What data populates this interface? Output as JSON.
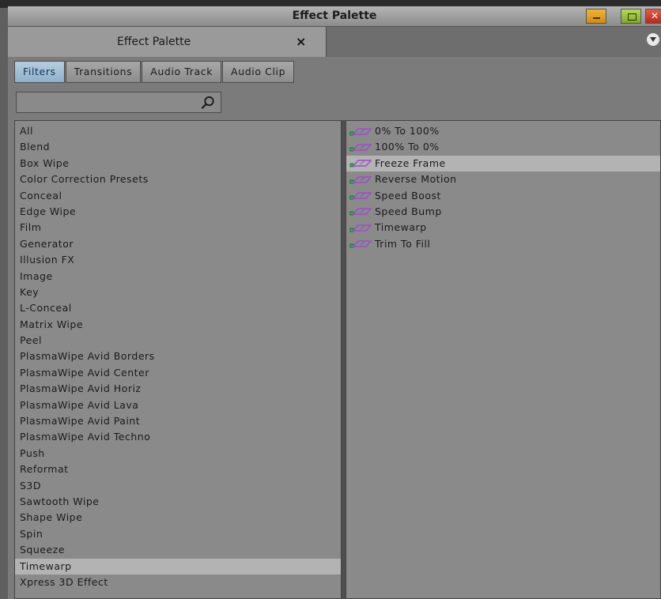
{
  "window": {
    "title": "Effect Palette",
    "controls": {
      "minimize_icon": "minimize-icon",
      "maximize_icon": "maximize-icon",
      "close_icon": "window-close-icon"
    }
  },
  "panel_tab": {
    "label": "Effect Palette",
    "close_glyph": "×"
  },
  "filter_tabs": [
    {
      "label": "Filters",
      "selected": true
    },
    {
      "label": "Transitions",
      "selected": false
    },
    {
      "label": "Audio Track",
      "selected": false
    },
    {
      "label": "Audio Clip",
      "selected": false
    }
  ],
  "search": {
    "value": "",
    "placeholder": "",
    "icon": "search-icon"
  },
  "categories": {
    "items": [
      "All",
      "Blend",
      "Box Wipe",
      "Color Correction Presets",
      "Conceal",
      "Edge Wipe",
      "Film",
      "Generator",
      "Illusion FX",
      "Image",
      "Key",
      "L-Conceal",
      "Matrix Wipe",
      "Peel",
      "PlasmaWipe Avid Borders",
      "PlasmaWipe Avid Center",
      "PlasmaWipe Avid Horiz",
      "PlasmaWipe Avid Lava",
      "PlasmaWipe Avid Paint",
      "PlasmaWipe Avid Techno",
      "Push",
      "Reformat",
      "S3D",
      "Sawtooth Wipe",
      "Shape Wipe",
      "Spin",
      "Squeeze",
      "Timewarp",
      "Xpress 3D Effect"
    ],
    "selected": "Timewarp"
  },
  "effects": {
    "items": [
      "0% To 100%",
      "100% To 0%",
      "Freeze Frame",
      "Reverse Motion",
      "Speed Boost",
      "Speed Bump",
      "Timewarp",
      "Trim To Fill"
    ],
    "selected": "Freeze Frame",
    "icon": "effect-template-icon"
  },
  "colors": {
    "selected_tab": "#9fbdd6",
    "effect_icon_green": "#2fb54a",
    "effect_icon_purple": "#9b4ec9",
    "row_highlight": "#b3b3b3"
  }
}
